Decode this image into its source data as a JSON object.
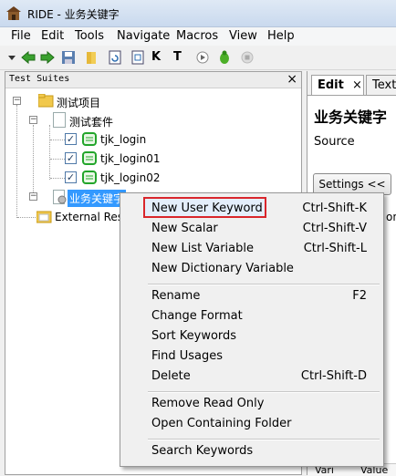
{
  "window": {
    "title": "RIDE - 业务关键字"
  },
  "menubar": [
    "File",
    "Edit",
    "Tools",
    "Navigate",
    "Macros",
    "View",
    "Help"
  ],
  "toolbar": {
    "keyword_k": "K",
    "keyword_t": "T"
  },
  "left_panel": {
    "header": "Test Suites",
    "close": "×"
  },
  "tree": {
    "project": "测试项目",
    "suite": "测试套件",
    "tests": [
      "tjk_login",
      "tjk_login01",
      "tjk_login02"
    ],
    "resource": "业务关键字",
    "external": "External Res"
  },
  "right_panel": {
    "tabs": [
      {
        "label": "Edit",
        "close": "×"
      },
      {
        "label": "Text"
      }
    ],
    "heading": "业务关键字",
    "source_label": "Source",
    "settings_button": "Settings <<",
    "partial_text": "on",
    "footer_cols": [
      "Vari",
      "Value"
    ]
  },
  "context_menu": {
    "groups": [
      [
        {
          "label": "New User Keyword",
          "shortcut": "Ctrl-Shift-K",
          "highlighted": true
        },
        {
          "label": "New Scalar",
          "shortcut": "Ctrl-Shift-V"
        },
        {
          "label": "New List Variable",
          "shortcut": "Ctrl-Shift-L"
        },
        {
          "label": "New Dictionary Variable",
          "shortcut": ""
        }
      ],
      [
        {
          "label": "Rename",
          "shortcut": "F2"
        },
        {
          "label": "Change Format",
          "shortcut": ""
        },
        {
          "label": "Sort Keywords",
          "shortcut": ""
        },
        {
          "label": "Find Usages",
          "shortcut": ""
        },
        {
          "label": "Delete",
          "shortcut": "Ctrl-Shift-D"
        }
      ],
      [
        {
          "label": "Remove Read Only",
          "shortcut": ""
        },
        {
          "label": "Open Containing Folder",
          "shortcut": ""
        }
      ],
      [
        {
          "label": "Search Keywords",
          "shortcut": ""
        }
      ]
    ]
  },
  "colors": {
    "highlight_border": "#d9262c",
    "selection": "#3399ff",
    "test_icon_green": "#22a52b"
  }
}
